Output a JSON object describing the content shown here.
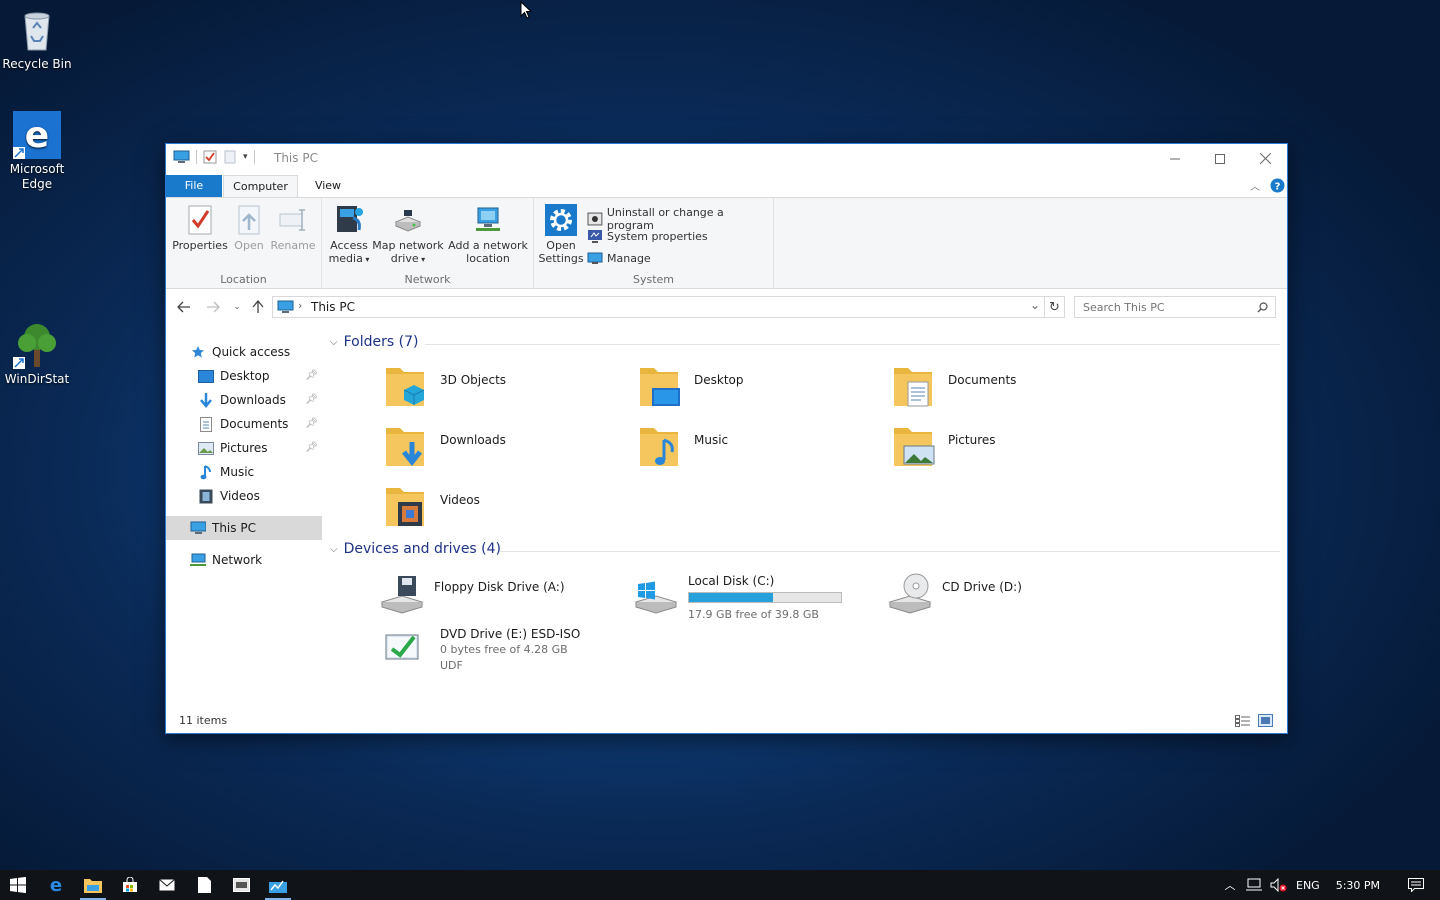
{
  "desktop": {
    "icons": [
      {
        "label": "Recycle Bin"
      },
      {
        "label": "Microsoft\nEdge"
      },
      {
        "label": "WinDirStat"
      }
    ]
  },
  "window": {
    "title": "This PC",
    "tabs": {
      "file": "File",
      "computer": "Computer",
      "view": "View"
    },
    "ribbon": {
      "location": {
        "label": "Location",
        "properties": "Properties",
        "open": "Open",
        "rename": "Rename"
      },
      "network": {
        "label": "Network",
        "access_media_1": "Access",
        "access_media_2": "media",
        "map_drive_1": "Map network",
        "map_drive_2": "drive",
        "add_location_1": "Add a network",
        "add_location_2": "location"
      },
      "system": {
        "label": "System",
        "open_settings_1": "Open",
        "open_settings_2": "Settings",
        "uninstall": "Uninstall or change a program",
        "system_properties": "System properties",
        "manage": "Manage"
      }
    },
    "address": {
      "path": "This PC",
      "search_placeholder": "Search This PC"
    },
    "nav": {
      "quick_access": "Quick access",
      "desktop": "Desktop",
      "downloads": "Downloads",
      "documents": "Documents",
      "pictures": "Pictures",
      "music": "Music",
      "videos": "Videos",
      "this_pc": "This PC",
      "network": "Network"
    },
    "folders": {
      "header": "Folders (7)",
      "items": [
        "3D Objects",
        "Desktop",
        "Documents",
        "Downloads",
        "Music",
        "Pictures",
        "Videos"
      ]
    },
    "drives": {
      "header": "Devices and drives (4)",
      "floppy": "Floppy Disk Drive (A:)",
      "local_disk": "Local Disk (C:)",
      "local_disk_free": "17.9 GB free of 39.8 GB",
      "local_disk_used_fraction": 0.55,
      "cd": "CD Drive (D:)",
      "dvd": "DVD Drive (E:) ESD-ISO",
      "dvd_free": "0 bytes free of 4.28 GB",
      "dvd_fs": "UDF"
    },
    "status": {
      "count": "11 items"
    }
  },
  "taskbar": {
    "language": "ENG",
    "time": "5:30 PM"
  },
  "colors": {
    "accent": "#1979ca",
    "progress": "#26a0da",
    "folder": "#f4c65d"
  }
}
